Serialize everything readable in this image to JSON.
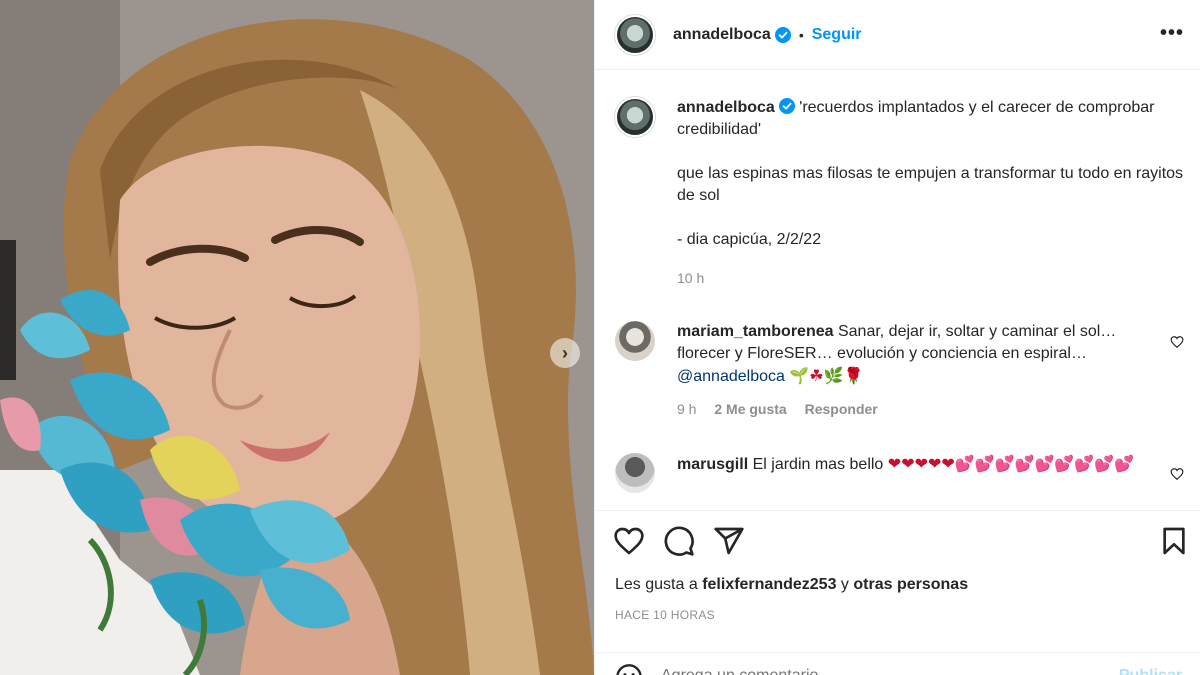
{
  "post": {
    "author": "annadelboca",
    "follow_label": "Seguir",
    "separator": "•",
    "more_label": "•••",
    "caption_lines": [
      "'recuerdos implantados y el carecer de comprobar credibilidad'",
      "que las espinas mas filosas te empujen a transformar tu todo en rayitos de sol",
      "- dia capicúa, 2/2/22"
    ],
    "caption_age": "10 h",
    "carousel_next": "›"
  },
  "comments": [
    {
      "user": "mariam_tamborenea",
      "text": "Sanar, dejar ir, soltar y caminar el sol… florecer y FloreSER… evolución y conciencia en espiral…",
      "mention": "@annadelboca",
      "emojis": "🌱☘🌿🌹",
      "age": "9 h",
      "likes": "2 Me gusta",
      "reply": "Responder"
    },
    {
      "user": "marusgill",
      "text": "El jardin mas bello",
      "emojis": "❤❤❤❤❤💕💕💕💕💕💕💕💕💕"
    }
  ],
  "likes_line": {
    "prefix": "Les gusta a",
    "user": "felixfernandez253",
    "middle": "y",
    "suffix": "otras personas"
  },
  "timestamp": "HACE 10 HORAS",
  "composer": {
    "placeholder": "Agrega un comentario...",
    "publish": "Publicar"
  },
  "icons": [
    "heart-icon",
    "comment-icon",
    "share-icon",
    "bookmark-icon",
    "verified-icon",
    "smile-icon",
    "chevron-right-icon",
    "more-icon"
  ],
  "colors": {
    "accent": "#0095f6",
    "text": "#262626",
    "muted": "#8e8e8e",
    "publish_disabled": "#b2dffc"
  }
}
